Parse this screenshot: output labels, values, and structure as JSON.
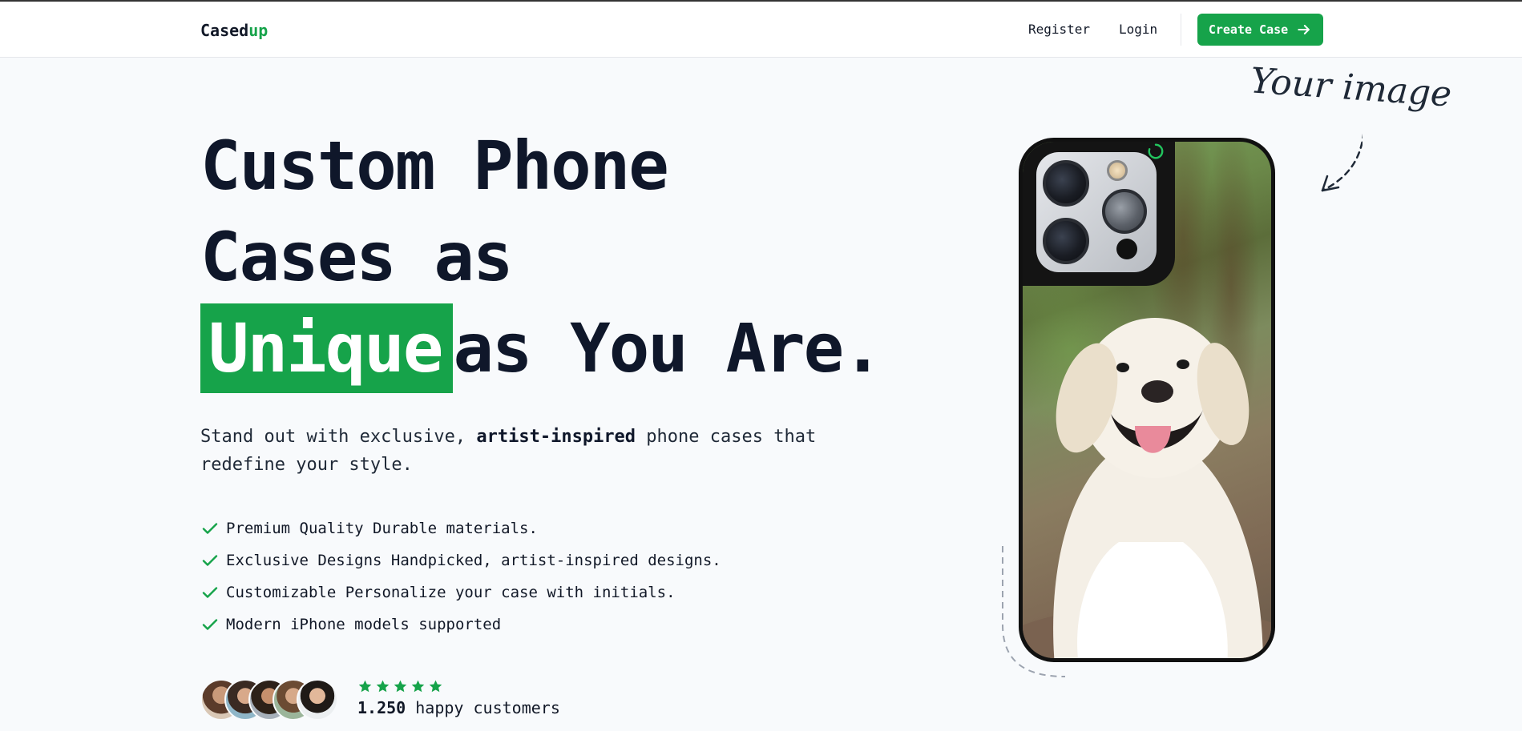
{
  "brand": {
    "name_main": "Cased",
    "name_accent": "up",
    "accent_color": "#16a34a"
  },
  "nav": {
    "register": "Register",
    "login": "Login",
    "cta": "Create Case",
    "cta_icon": "arrow-right-icon"
  },
  "hero": {
    "line1": "Custom Phone",
    "line2": "Cases as",
    "highlight": "Unique",
    "line3_rest": "as You Are.",
    "sub_before": "Stand out with exclusive, ",
    "sub_bold": "artist-inspired",
    "sub_after": " phone cases that redefine your style."
  },
  "features": [
    "Premium Quality Durable materials.",
    "Exclusive Designs Handpicked, artist-inspired designs.",
    "Customizable Personalize your case with initials.",
    "Modern iPhone models supported"
  ],
  "social_proof": {
    "rating_stars": 5,
    "count": "1.250",
    "label": " happy customers"
  },
  "annotation": {
    "text": "Your image"
  },
  "colors": {
    "primary": "#16a34a",
    "text": "#0f172a",
    "background": "#f8fafc"
  }
}
